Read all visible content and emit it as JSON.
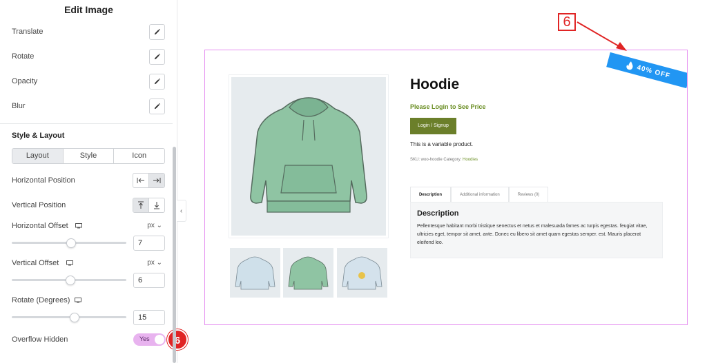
{
  "panel": {
    "title": "Edit Image",
    "transform_rows": [
      {
        "label": "Translate"
      },
      {
        "label": "Rotate"
      },
      {
        "label": "Opacity"
      },
      {
        "label": "Blur"
      }
    ],
    "section_title": "Style & Layout",
    "tabs": [
      "Layout",
      "Style",
      "Icon"
    ],
    "active_tab": "Layout",
    "horizontal_position": {
      "label": "Horizontal Position",
      "selected": "right"
    },
    "vertical_position": {
      "label": "Vertical Position",
      "selected": "top"
    },
    "horizontal_offset": {
      "label": "Horizontal Offset",
      "unit": "px ⌄",
      "value": "7",
      "slider_fraction": 0.52
    },
    "vertical_offset": {
      "label": "Vertical Offset",
      "unit": "px ⌄",
      "value": "6",
      "slider_fraction": 0.51
    },
    "rotate": {
      "label": "Rotate (Degrees)",
      "value": "15",
      "slider_fraction": 0.55
    },
    "overflow_hidden": {
      "label": "Overflow Hidden",
      "toggle_text": "Yes",
      "enabled": true
    },
    "step_badge": "6"
  },
  "preview": {
    "title": "Hoodie",
    "price_note": "Please Login to See Price",
    "login_button": "Login / Signup",
    "short_description": "This is a variable product.",
    "meta_prefix": "SKU: woo-hoodie Category:",
    "meta_category": "Hoodies",
    "tabs": [
      "Description",
      "Additional information",
      "Reviews (0)"
    ],
    "desc_title": "Description",
    "desc_text": "Pellentesque habitant morbi tristique senectus et netus et malesuada fames ac turpis egestas. feugiat vitae, ultricies eget, tempor sit amet, ante. Donec eu libero sit amet quam egestas semper. est. Mauris placerat eleifend leo.",
    "ribbon_text": "40% OFF",
    "hoodie_color": "#8fc4a3",
    "ribbon_color": "#2196f3"
  },
  "annotation": {
    "label": "6",
    "color": "#e02424"
  }
}
